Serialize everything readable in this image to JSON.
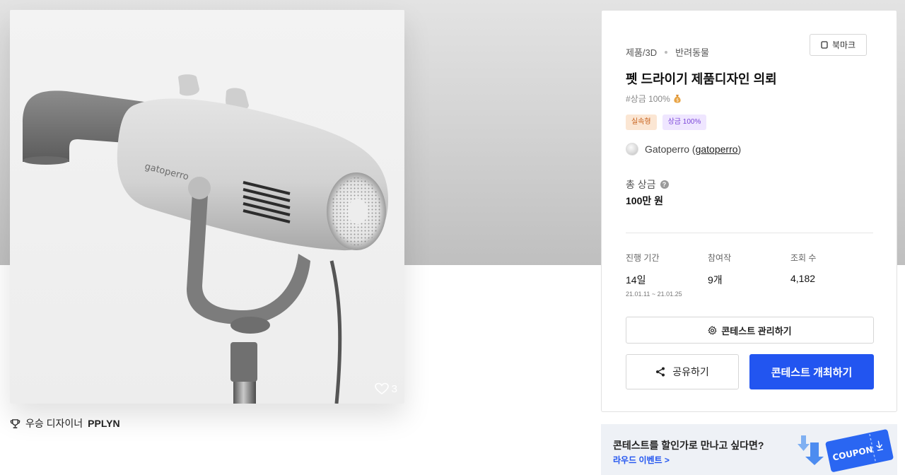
{
  "gallery": {
    "brand_mark": "gatoperro",
    "like_count": "3"
  },
  "winner": {
    "prefix": "우승 디자이너",
    "name": "PPLYN"
  },
  "contest": {
    "category": "제품/3D",
    "subcategory": "반려동물",
    "bookmark_label": "북마크",
    "title": "펫 드라이기 제품디자인 의뢰",
    "hashtag": "#상금 100%",
    "badges": [
      "실속형",
      "상금 100%"
    ],
    "host_name": "Gatoperro (",
    "host_handle": "gatoperro",
    "host_close": ")",
    "prize_label": "총 상금",
    "prize_value": "100만 원",
    "stats": {
      "period_label": "진행 기간",
      "period_value": "14일",
      "period_dates": "21.01.11 ~ 21.01.25",
      "entries_label": "참여작",
      "entries_value": "9개",
      "views_label": "조회 수",
      "views_value": "4,182"
    },
    "manage_label": "콘테스트 관리하기",
    "share_label": "공유하기",
    "host_button_label": "콘테스트 개최하기"
  },
  "coupon_banner": {
    "title": "콘테스트를 할인가로 만나고 싶다면?",
    "link": "라우드 이벤트 >",
    "ticket_text": "COUPON"
  },
  "colors": {
    "primary": "#2255f0",
    "badge_orange_bg": "#fbe6d3",
    "badge_purple_bg": "#efe6ff"
  },
  "icons": [
    "heart-icon",
    "trophy-icon",
    "bookmark-icon",
    "coin-bag-icon",
    "question-icon",
    "gear-icon",
    "share-icon",
    "download-arrow-icon"
  ]
}
